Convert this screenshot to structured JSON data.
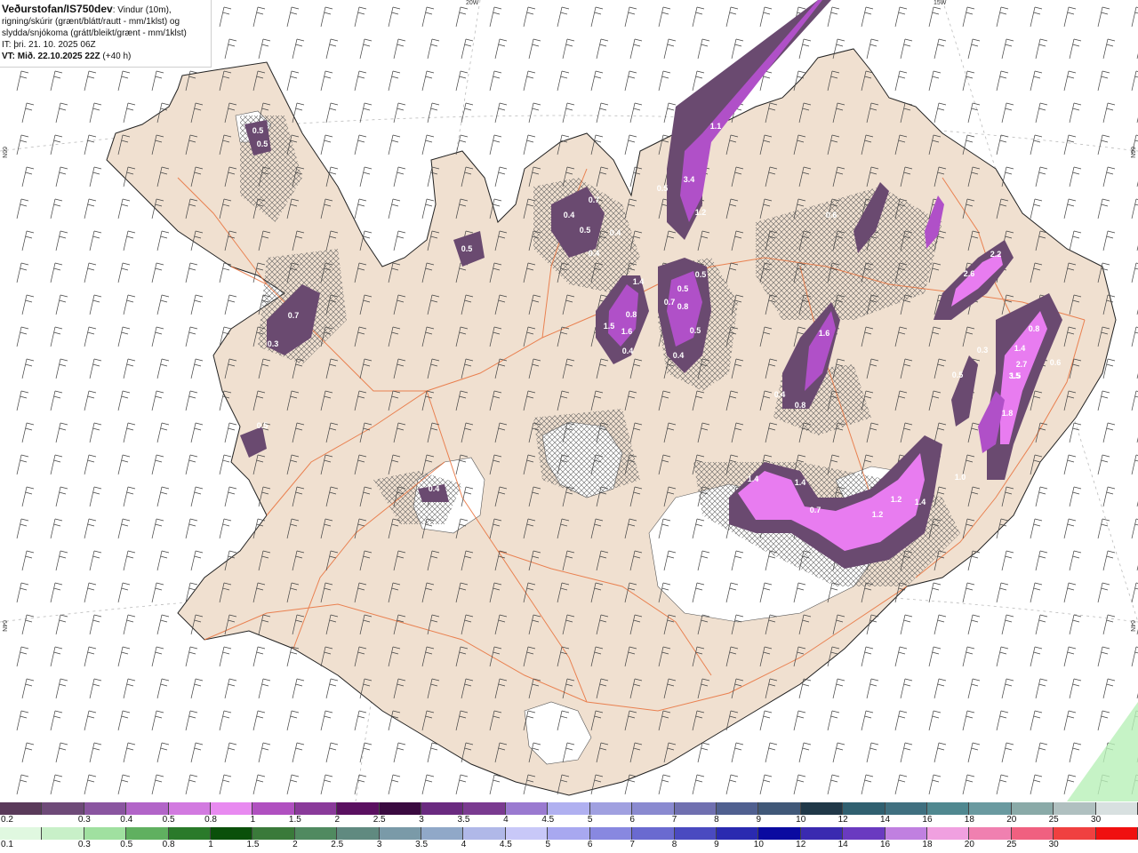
{
  "header": {
    "brand": "Veðurstofan/IS750dev",
    "description_line1": ": Vindur (10m),",
    "description_line2": "rigning/skúrir (grænt/blátt/rautt - mm/1klst) og",
    "description_line3": "slydda/snjókoma (grátt/bleikt/grænt - mm/1klst)",
    "issue_time": "IT: þri. 21. 10. 2025 06Z",
    "valid_time": "VT: Mið. 22.10.2025 22Z",
    "lead": "(+40 h)"
  },
  "graticule": {
    "lon_20w": "20W",
    "lon_15w": "15W",
    "lat_66n_left": "66N",
    "lat_66n_right": "66N",
    "lat_64n_left": "64N",
    "lat_64n_right": "64N"
  },
  "precip_labels": [
    "0.5",
    "0.5",
    "0.5",
    "0.4",
    "0.7",
    "0.4",
    "0.5",
    "0.4",
    "0.3",
    "0.7",
    "1.1",
    "3.4",
    "1.2",
    "0.5",
    "1.4",
    "0.8",
    "1.6",
    "0.4",
    "0.7",
    "0.5",
    "0.8",
    "0.5",
    "1.5",
    "0.5",
    "0.4",
    "0.6",
    "0.4",
    "0.8",
    "1.6",
    "2.6",
    "2.2",
    "1.4",
    "2.7",
    "1.5",
    "3.5",
    "0.8",
    "0.3",
    "0.6",
    "1.8",
    "1.0",
    "0.5",
    "1.4",
    "1.2",
    "1.4",
    "1.2",
    "0.7",
    "1.4",
    "0.4",
    "0.5"
  ],
  "legend_snow": {
    "colors": [
      "#5a3a5a",
      "#6e4a78",
      "#8a55a0",
      "#b265c8",
      "#d27ae0",
      "#e88af0",
      "#b050c0",
      "#8a3a9a",
      "#5a1060",
      "#3a0a40",
      "#6a2a80",
      "#7a3a90",
      "#9a7ad0",
      "#b0b0f0",
      "#a0a0e0",
      "#8a8ad0",
      "#7070b0",
      "#506090",
      "#405878",
      "#203848",
      "#306070",
      "#407080",
      "#508890",
      "#6a9aa0",
      "#8aaaa8",
      "#b0c0c0",
      "#d8e0e0"
    ],
    "labels": [
      "0.2",
      "0.3",
      "0.4",
      "0.5",
      "0.8",
      "1",
      "1.5",
      "2",
      "2.5",
      "3",
      "3.5",
      "4",
      "4.5",
      "5",
      "6",
      "7",
      "8",
      "9",
      "10",
      "12",
      "14",
      "16",
      "18",
      "20",
      "25",
      "30"
    ]
  },
  "legend_rain": {
    "colors": [
      "#e0f8e0",
      "#c8f0c8",
      "#a0e0a0",
      "#60b060",
      "#2a7a2a",
      "#0a500a",
      "#3a7a3a",
      "#508a60",
      "#608a80",
      "#7a9aa8",
      "#90a8c8",
      "#b0b8e8",
      "#c8c8f8",
      "#a8a8f0",
      "#8888e0",
      "#6a6ad0",
      "#4a4ac0",
      "#2a2ab0",
      "#0a0aa0",
      "#3a2ab0",
      "#6a3ac0",
      "#c080e0",
      "#f0a0e0",
      "#f080b0",
      "#f06080",
      "#f04040",
      "#f01010"
    ],
    "labels": [
      "0.1",
      "0.3",
      "0.5",
      "0.8",
      "1",
      "1.5",
      "2",
      "2.5",
      "3",
      "3.5",
      "4",
      "4.5",
      "5",
      "6",
      "7",
      "8",
      "9",
      "10",
      "12",
      "14",
      "16",
      "18",
      "20",
      "25",
      "30"
    ]
  },
  "colors": {
    "land": "#f0e0d0",
    "road": "#e8703a",
    "precip_light": "#6a4a70",
    "precip_mid": "#b050c8",
    "precip_heavy": "#f07cf8",
    "ice": "#ffffff",
    "rain_green": "#b8f0b8"
  }
}
